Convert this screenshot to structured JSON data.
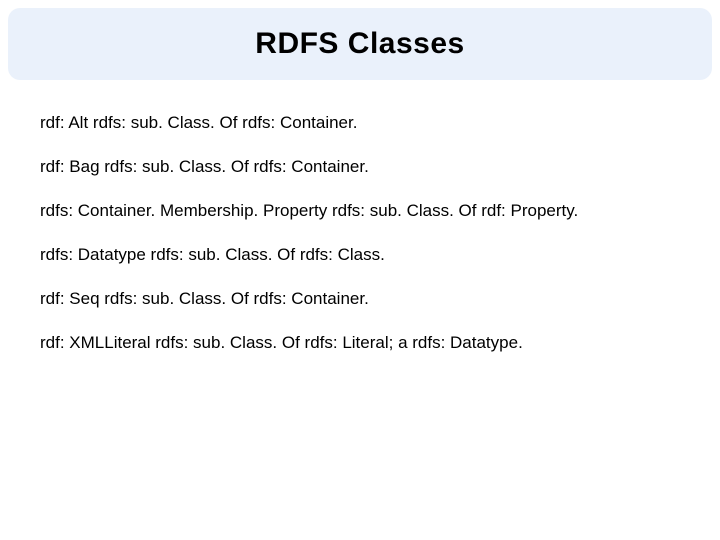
{
  "title": "RDFS Classes",
  "lines": [
    "rdf: Alt rdfs: sub. Class. Of rdfs: Container.",
    "rdf: Bag rdfs: sub. Class. Of rdfs: Container.",
    "rdfs: Container. Membership. Property rdfs: sub. Class. Of rdf: Property.",
    "rdfs: Datatype rdfs: sub. Class. Of rdfs: Class.",
    "rdf: Seq rdfs: sub. Class. Of rdfs: Container.",
    "rdf: XMLLiteral rdfs: sub. Class. Of rdfs: Literal; a rdfs: Datatype."
  ]
}
